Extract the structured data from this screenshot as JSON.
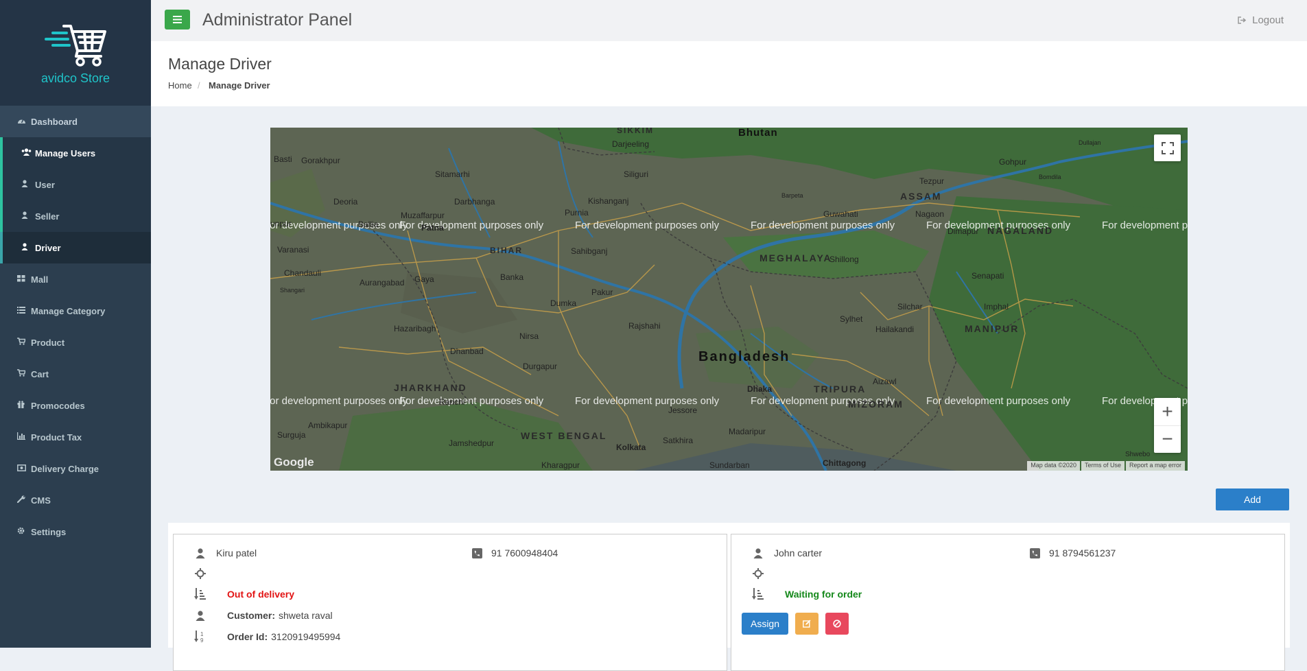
{
  "brand": {
    "name": "avidco Store",
    "icon": "cart-logo-icon"
  },
  "sidebar": {
    "items": [
      {
        "label": "Dashboard",
        "icon": "dashboard-icon"
      },
      {
        "label": "Manage Users",
        "icon": "users-icon"
      },
      {
        "label": "User",
        "icon": "user-icon"
      },
      {
        "label": "Seller",
        "icon": "user-icon"
      },
      {
        "label": "Driver",
        "icon": "user-icon"
      },
      {
        "label": "Mall",
        "icon": "grid-icon"
      },
      {
        "label": "Manage Category",
        "icon": "list-icon"
      },
      {
        "label": "Product",
        "icon": "cart-icon"
      },
      {
        "label": "Cart",
        "icon": "cart-icon"
      },
      {
        "label": "Promocodes",
        "icon": "gift-icon"
      },
      {
        "label": "Product Tax",
        "icon": "bar-chart-icon"
      },
      {
        "label": "Delivery Charge",
        "icon": "money-icon"
      },
      {
        "label": "CMS",
        "icon": "wrench-icon"
      },
      {
        "label": "Settings",
        "icon": "gear-icon"
      }
    ]
  },
  "header": {
    "title": "Administrator Panel",
    "logout": "Logout"
  },
  "page": {
    "title": "Manage Driver",
    "breadcrumb": {
      "home": "Home",
      "sep": "/",
      "current": "Manage Driver"
    }
  },
  "map": {
    "labels": {
      "bhutan": "Bhutan",
      "sikkim": "SIKKIM",
      "assam": "ASSAM",
      "meghalaya": "MEGHALAYA",
      "nagaland": "NAGALAND",
      "manipur": "MANIPUR",
      "mizoram": "MIZORAM",
      "tripura": "TRIPURA",
      "bangladesh": "Bangladesh",
      "jharkhand": "JHARKHAND",
      "westbengal": "WEST BENGAL",
      "bihar": "BIHAR",
      "gorakhpur": "Gorakhpur",
      "sitamarhi": "Sitamarhi",
      "darbhanga": "Darbhanga",
      "muzaffarpur": "Muzaffarpur",
      "deoria": "Deoria",
      "ballia": "Ballia",
      "patna": "Patna",
      "varanasi": "Varanasi",
      "purnia": "Purnia",
      "kishanganj": "Kishanganj",
      "siliguri": "Siliguri",
      "darjeeling": "Darjeeling",
      "guwahati": "Guwahati",
      "shillong": "Shillong",
      "tezpur": "Tezpur",
      "gohpur": "Gohpur",
      "nagaon": "Nagaon",
      "dimapur": "Dimapur",
      "imphal": "Imphal",
      "silchar": "Silchar",
      "sylhet": "Sylhet",
      "dhaka": "Dhaka",
      "rajshahi": "Rajshahi",
      "kolkata": "Kolkata",
      "chittagong": "Chittagong",
      "hazaribagh": "Hazaribagh",
      "dhanbad": "Dhanbad",
      "durgapur": "Durgapur",
      "jamshedpur": "Jamshedpur",
      "gaya": "Gaya",
      "aurangabad": "Aurangabad",
      "chandauli": "Chandauli",
      "dumka": "Dumka",
      "banka": "Banka",
      "pakur": "Pakur",
      "jessore": "Jessore",
      "aizawl": "Aizawl",
      "kharagpur": "Kharagpur",
      "basti": "Basti",
      "nirsa": "Nirsa",
      "madaripur": "Madaripur",
      "satkhira": "Satkhira",
      "ranchi": "Ranchi",
      "sahibganj": "Sahibganj",
      "hailakandi": "Hailakandi",
      "sundarban": "Sundarban",
      "shwebo": "Shwebo",
      "senapati": "Senapati",
      "bomdila": "Bomdila",
      "dullajan": "Dullajan",
      "surguja": "Surguja",
      "ambikapur": "Ambikapur",
      "barpeta": "Barpeta",
      "shangari": "Shangari",
      "unpur": "unpur"
    },
    "watermark": "For development purposes only",
    "footer": {
      "data": "Map data ©2020",
      "terms": "Terms of Use",
      "report": "Report a map error"
    },
    "google": "Google",
    "fullscreen_icon": "fullscreen-icon",
    "zoom_in": "+",
    "zoom_out": "−"
  },
  "add_button": "Add",
  "drivers": [
    {
      "name": "Kiru patel",
      "phone": "91 7600948404",
      "status": "Out of delivery",
      "status_color": "#e21313",
      "customer_label": "Customer:",
      "customer": "shweta raval",
      "order_label": "Order Id:",
      "order_id": "3120919495994"
    },
    {
      "name": "John carter",
      "phone": "91 8794561237",
      "status": "Waiting for order",
      "status_color": "#14881a",
      "assign": "Assign"
    }
  ],
  "colors": {
    "sidebar": "#2c3e4f",
    "accent_green": "#3aa74a",
    "primary": "#2b7fc9",
    "warning": "#f0ad4e",
    "danger": "#e8485d",
    "brand_teal": "#1fc4c9"
  }
}
